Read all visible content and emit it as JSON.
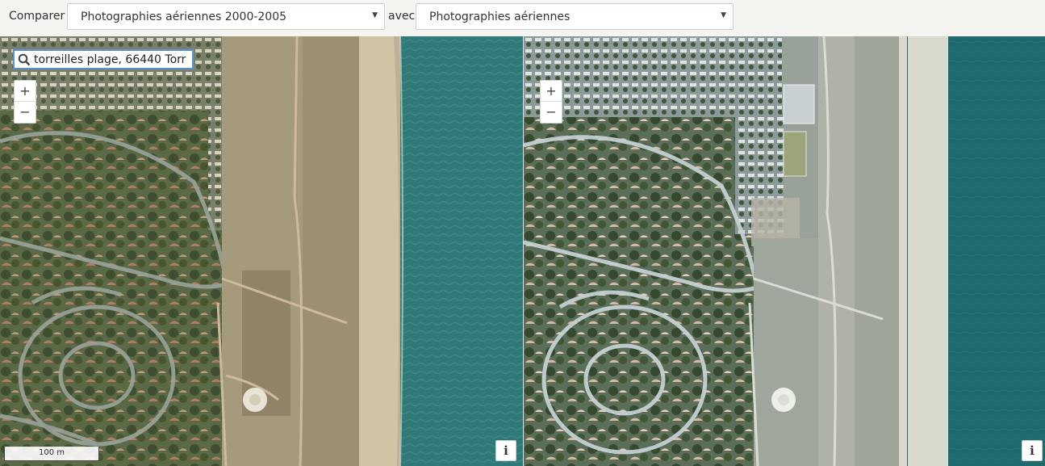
{
  "toolbar": {
    "compare_label": "Comparer",
    "with_label": "avec",
    "left_layer": "Photographies aériennes 2000-2005",
    "right_layer": "Photographies aériennes"
  },
  "search": {
    "value": "torreilles plage, 66440 Torr"
  },
  "zoom": {
    "in_label": "+",
    "out_label": "−"
  },
  "scale": {
    "label": "100 m"
  },
  "info": {
    "label": "i"
  },
  "colors": {
    "sea_old": "#2f7a78",
    "sea_new": "#1f6a6d",
    "sand": "#c9b99f",
    "vegetation": "#6d7a55",
    "accent_border": "#5b8fd6"
  }
}
